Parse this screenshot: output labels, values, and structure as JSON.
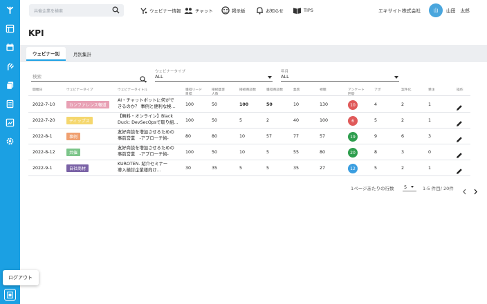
{
  "sidebar": {
    "icons": [
      "mascot-icon",
      "list-icon",
      "calendar-icon",
      "hand-icon",
      "copy-icon",
      "document-icon",
      "chart-icon",
      "gear-icon"
    ]
  },
  "header": {
    "search_placeholder": "共催企業を検索",
    "nav": [
      "ウェビナー情報",
      "チャット",
      "掲示板",
      "お知らせ",
      "TIPS"
    ],
    "company": "エキサイト株式会社",
    "avatar": "山",
    "user": "山田　太郎"
  },
  "page": {
    "title": "KPI"
  },
  "tabs": [
    "ウェビナー別",
    "月別集計"
  ],
  "filters": {
    "search_placeholder": "検索",
    "type_label": "ウェビナータイプ",
    "type_value": "ALL",
    "month_label": "年月",
    "month_value": "ALL"
  },
  "table": {
    "headers": [
      "開催日",
      "ウェビナータイプ",
      "ウェビナータイトル",
      "獲得リード\n目標",
      "接続集客\n人数",
      "接続商談数",
      "獲得商談数",
      "集客",
      "視聴",
      "アンケート\n回答",
      "アポ",
      "案件化",
      "受注",
      "操作"
    ],
    "rows": [
      {
        "date": "2022-7-10",
        "type": "カンファレンス報道",
        "type_color": "#e8a0b4",
        "title1": "AI・チャットボットに何がで",
        "title2": "きるのか？ 事例と便利な検…",
        "c1": "100",
        "c2": "50",
        "c3": "100",
        "c4": "50",
        "c5": "10",
        "c6": "130",
        "survey": "10",
        "survey_color": "#e05a5a",
        "c7": "4",
        "c8": "2",
        "c9": "1",
        "bold": true
      },
      {
        "date": "2022-7-20",
        "type": "ティップス",
        "type_color": "#f5d76e",
        "title1": "【無料・オンライン】Black",
        "title2": "Duck: DevSecOpsで取り組…",
        "c1": "100",
        "c2": "50",
        "c3": "5",
        "c4": "2",
        "c5": "40",
        "c6": "100",
        "survey": "6",
        "survey_color": "#e05a5a",
        "c7": "5",
        "c8": "2",
        "c9": "1",
        "bold": false
      },
      {
        "date": "2022-8-1",
        "type": "事例",
        "type_color": "#f0a070",
        "title1": "友好商談を増加させるための",
        "title2": "事前営業　-アプローチ術-",
        "c1": "80",
        "c2": "80",
        "c3": "10",
        "c4": "57",
        "c5": "77",
        "c6": "57",
        "survey": "19",
        "survey_color": "#2e9e4e",
        "c7": "9",
        "c8": "6",
        "c9": "3",
        "bold": false
      },
      {
        "date": "2022-8-12",
        "type": "共催",
        "type_color": "#7cc58a",
        "title1": "友好商談を増加させるための",
        "title2": "事前営業　-アプローチ術-",
        "c1": "100",
        "c2": "50",
        "c3": "10",
        "c4": "5",
        "c5": "55",
        "c6": "80",
        "survey": "20",
        "survey_color": "#2e9e4e",
        "c7": "8",
        "c8": "3",
        "c9": "0",
        "bold": false
      },
      {
        "date": "2022-9-1",
        "type": "自社商材",
        "type_color": "#7a62a6",
        "title1": "KUROTEN. 紹介セミナー",
        "title2": "導入検討企業様向け…",
        "c1": "30",
        "c2": "35",
        "c3": "5",
        "c4": "5",
        "c5": "35",
        "c6": "27",
        "survey": "12",
        "survey_color": "#3b9ee0",
        "c7": "5",
        "c8": "2",
        "c9": "1",
        "bold": false
      }
    ]
  },
  "pagination": {
    "rows_label": "1ページあたりの行数",
    "rows_value": "5",
    "range": "1-5 件目/ 20件"
  },
  "logout": {
    "label": "ログアウト"
  }
}
